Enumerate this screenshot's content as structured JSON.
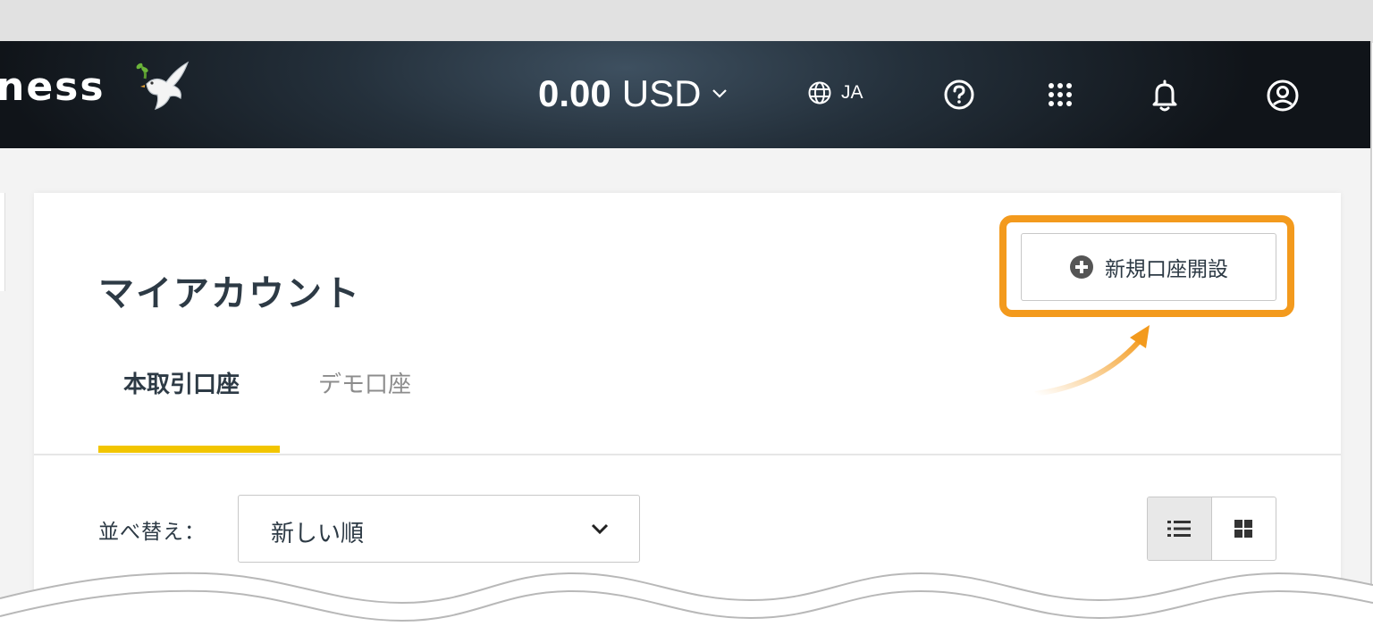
{
  "header": {
    "logo_text": "ness",
    "balance_amount": "0.00",
    "balance_currency": "USD",
    "language": "JA",
    "icons": [
      "globe-icon",
      "help-icon",
      "apps-grid-icon",
      "bell-icon",
      "user-icon"
    ]
  },
  "page": {
    "title": "マイアカウント",
    "new_account_button": "新規口座開設",
    "tabs": [
      {
        "label": "本取引口座",
        "active": true
      },
      {
        "label": "デモ口座",
        "active": false
      }
    ],
    "sort_label": "並べ替え：",
    "sort_value": "新しい順"
  },
  "colors": {
    "accent_yellow": "#f2c500",
    "highlight_orange": "#f39a1d",
    "text_dark": "#2d3a45"
  }
}
